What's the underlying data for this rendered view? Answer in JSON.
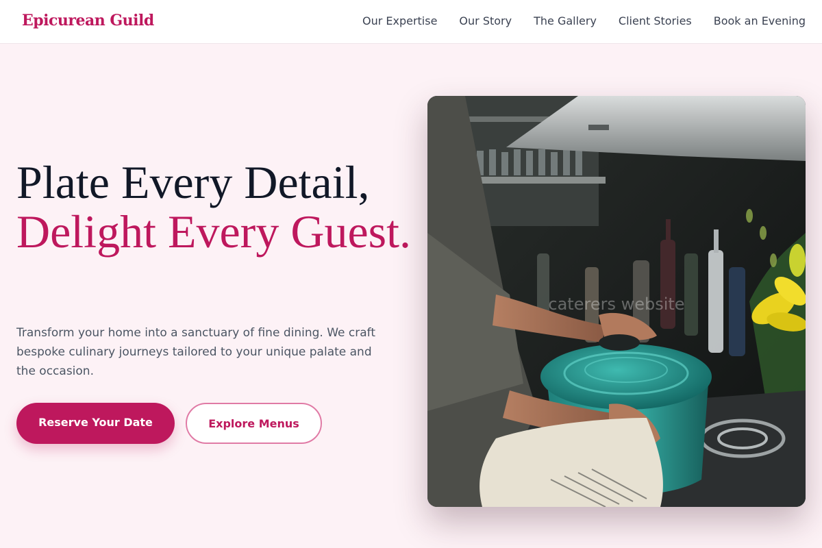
{
  "nav": {
    "brand": "Epicurean Guild",
    "links": [
      "Our Expertise",
      "Our Story",
      "The Gallery",
      "Client Stories",
      "Book an Evening"
    ]
  },
  "hero": {
    "title_line1": "Plate Every Detail,",
    "title_line2": "Delight Every Guest.",
    "subtitle": "Transform your home into a sanctuary of fine dining. We craft bespoke culinary journeys tailored to your unique palate and the occasion.",
    "primary_button": "Reserve Your Date",
    "secondary_button": "Explore Menus"
  },
  "image": {
    "watermark": "caterers website"
  },
  "colors": {
    "accent": "#be185d",
    "background": "#fdf2f6",
    "heading": "#111827",
    "body_text": "#4b5563"
  }
}
